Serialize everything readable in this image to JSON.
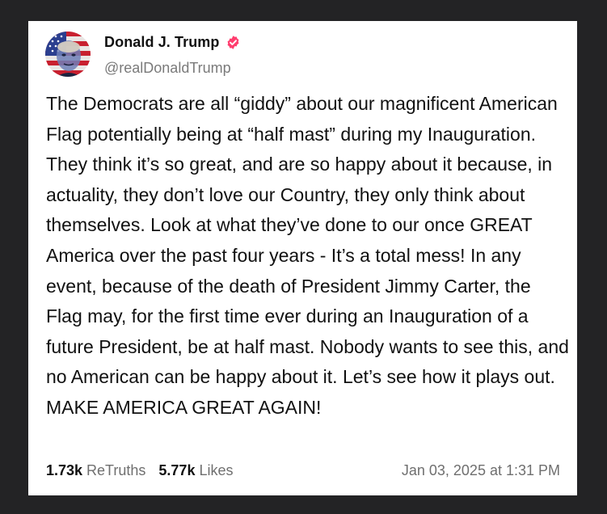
{
  "post": {
    "author": {
      "display_name": "Donald J. Trump",
      "handle": "@realDonaldTrump",
      "verified_icon": "verified-badge-icon",
      "avatar_icon": "avatar-image"
    },
    "text": "The Democrats are all “giddy” about our magnificent American Flag potentially being at “half mast” during my Inauguration. They think it’s so great, and are so happy about it because, in actuality, they don’t love our Country, they only think about themselves. Look at what they’ve done to our once GREAT America over the past four years - It’s a total mess! In any event, because of the death of President Jimmy Carter, the Flag may, for the first time ever during an Inauguration of a future President, be at half mast. Nobody wants to see this, and no American can be happy about it. Let’s see how it plays out. MAKE AMERICA GREAT AGAIN!",
    "stats": {
      "retruths_count": "1.73k",
      "retruths_label": "ReTruths",
      "likes_count": "5.77k",
      "likes_label": "Likes"
    },
    "timestamp": "Jan 03, 2025 at 1:31 PM"
  },
  "colors": {
    "page_background": "#232325",
    "card_background": "#ffffff",
    "verified_badge": "#ff3d6e",
    "muted_text": "#6f6f6f"
  }
}
